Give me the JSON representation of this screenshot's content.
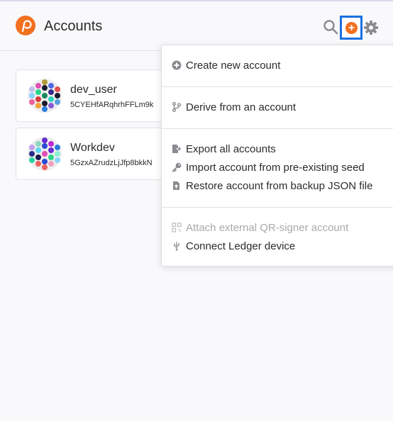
{
  "header": {
    "title": "Accounts",
    "icons": [
      "polkadot-logo-icon",
      "search-icon",
      "add-account-icon",
      "gear-icon"
    ],
    "add_glyph": "+"
  },
  "accounts": [
    {
      "name": "dev_user",
      "address": "5CYEHfARqhrhFFLm9k"
    },
    {
      "name": "Workdev",
      "address": "5GzxAZrudzLjJfp8bkkN"
    }
  ],
  "menu": {
    "create": "Create new account",
    "derive": "Derive from an account",
    "export_all": "Export all accounts",
    "import_seed": "Import account from pre-existing seed",
    "restore_json": "Restore account from backup JSON file",
    "attach_qr": "Attach external QR-signer account",
    "connect_ledger": "Connect Ledger device"
  },
  "colors": {
    "brand": "#f3701f",
    "focus_outline": "#1b6fe3",
    "icon_gray": "#8a8a90",
    "disabled_text": "#a9a9ae"
  }
}
